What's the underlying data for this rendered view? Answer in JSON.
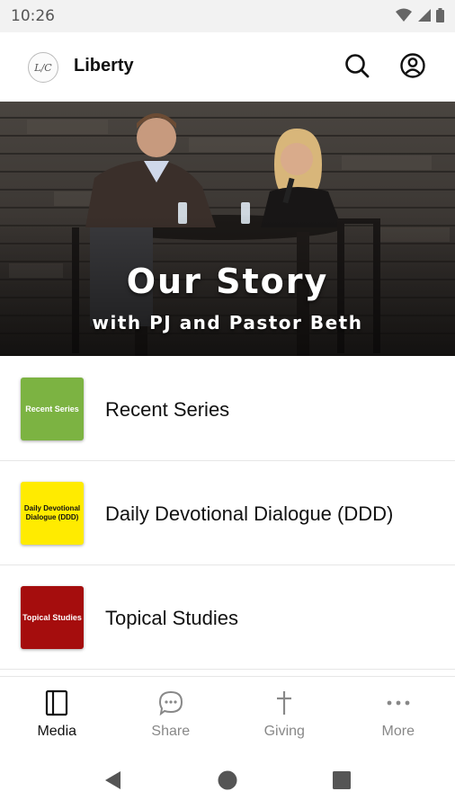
{
  "status": {
    "time": "10:26"
  },
  "app": {
    "title": "Liberty",
    "logo_text": "L/C"
  },
  "hero": {
    "title": "Our Story",
    "subtitle": "with PJ and Pastor Beth"
  },
  "list": [
    {
      "label": "Recent Series",
      "thumb_text": "Recent Series",
      "thumb_color": "#7cb342",
      "thumb_text_color": "#ffffff"
    },
    {
      "label": "Daily Devotional Dialogue (DDD)",
      "thumb_text": "Daily Devotional Dialogue (DDD)",
      "thumb_color": "#ffeb00",
      "thumb_text_color": "#111111"
    },
    {
      "label": "Topical Studies",
      "thumb_text": "Topical Studies",
      "thumb_color": "#a50d0d",
      "thumb_text_color": "#ffffff"
    }
  ],
  "nav": [
    {
      "label": "Media",
      "icon": "media-icon",
      "active": true
    },
    {
      "label": "Share",
      "icon": "chat-icon"
    },
    {
      "label": "Giving",
      "icon": "cross-icon"
    },
    {
      "label": "More",
      "icon": "more-icon"
    }
  ],
  "colors": {
    "accent_text": "#111111",
    "inactive_nav": "#888888"
  }
}
